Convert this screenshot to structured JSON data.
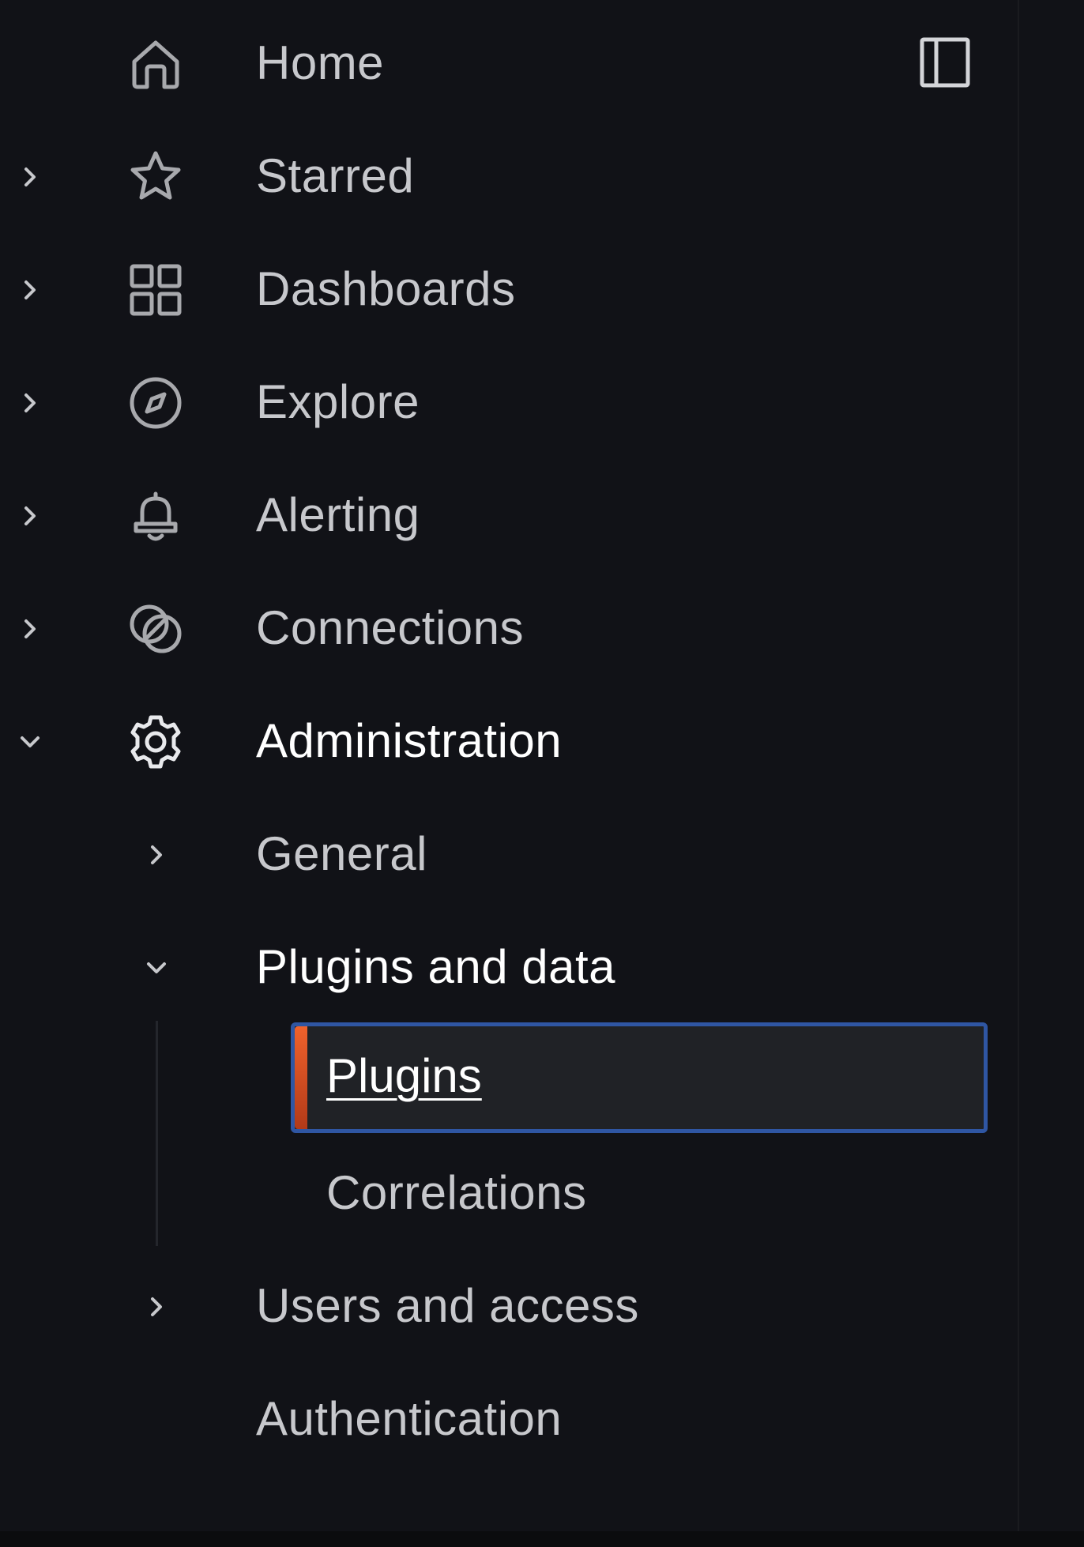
{
  "nav": {
    "dock_button": {
      "icon": "dock-panel-icon"
    },
    "items": [
      {
        "label": "Home",
        "icon": "home-icon",
        "expander": "none"
      },
      {
        "label": "Starred",
        "icon": "star-icon",
        "expander": "collapsed"
      },
      {
        "label": "Dashboards",
        "icon": "apps-grid-icon",
        "expander": "collapsed"
      },
      {
        "label": "Explore",
        "icon": "compass-icon",
        "expander": "collapsed"
      },
      {
        "label": "Alerting",
        "icon": "bell-icon",
        "expander": "collapsed"
      },
      {
        "label": "Connections",
        "icon": "connections-icon",
        "expander": "collapsed"
      },
      {
        "label": "Administration",
        "icon": "gear-icon",
        "expander": "expanded",
        "children": [
          {
            "label": "General",
            "expander": "collapsed"
          },
          {
            "label": "Plugins and data",
            "expander": "expanded",
            "children": [
              {
                "label": "Plugins",
                "active": true
              },
              {
                "label": "Correlations",
                "active": false
              }
            ]
          },
          {
            "label": "Users and access",
            "expander": "collapsed"
          },
          {
            "label": "Authentication",
            "expander": "none"
          }
        ]
      }
    ]
  },
  "colors": {
    "background": "#111217",
    "text_default": "#c7c8cc",
    "text_active": "#ffffff",
    "active_bg": "#202226",
    "focus_border": "#2f56a3",
    "active_accent": "#f0622c"
  }
}
